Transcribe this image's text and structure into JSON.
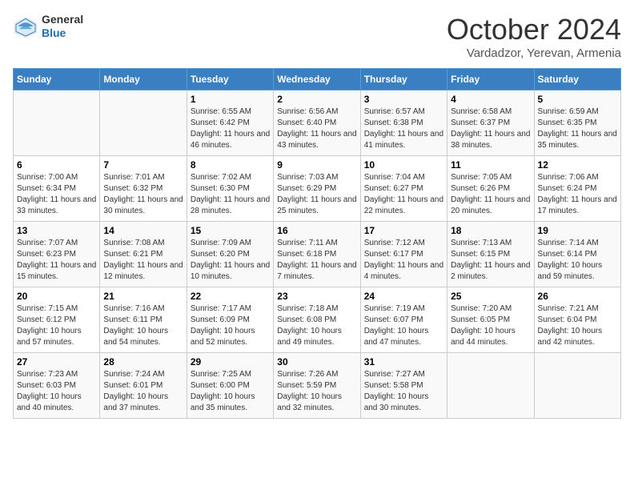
{
  "header": {
    "logo_general": "General",
    "logo_blue": "Blue",
    "month": "October 2024",
    "location": "Vardadzor, Yerevan, Armenia"
  },
  "days_of_week": [
    "Sunday",
    "Monday",
    "Tuesday",
    "Wednesday",
    "Thursday",
    "Friday",
    "Saturday"
  ],
  "weeks": [
    [
      {
        "day": "",
        "info": ""
      },
      {
        "day": "",
        "info": ""
      },
      {
        "day": "1",
        "sunrise": "Sunrise: 6:55 AM",
        "sunset": "Sunset: 6:42 PM",
        "daylight": "Daylight: 11 hours and 46 minutes."
      },
      {
        "day": "2",
        "sunrise": "Sunrise: 6:56 AM",
        "sunset": "Sunset: 6:40 PM",
        "daylight": "Daylight: 11 hours and 43 minutes."
      },
      {
        "day": "3",
        "sunrise": "Sunrise: 6:57 AM",
        "sunset": "Sunset: 6:38 PM",
        "daylight": "Daylight: 11 hours and 41 minutes."
      },
      {
        "day": "4",
        "sunrise": "Sunrise: 6:58 AM",
        "sunset": "Sunset: 6:37 PM",
        "daylight": "Daylight: 11 hours and 38 minutes."
      },
      {
        "day": "5",
        "sunrise": "Sunrise: 6:59 AM",
        "sunset": "Sunset: 6:35 PM",
        "daylight": "Daylight: 11 hours and 35 minutes."
      }
    ],
    [
      {
        "day": "6",
        "sunrise": "Sunrise: 7:00 AM",
        "sunset": "Sunset: 6:34 PM",
        "daylight": "Daylight: 11 hours and 33 minutes."
      },
      {
        "day": "7",
        "sunrise": "Sunrise: 7:01 AM",
        "sunset": "Sunset: 6:32 PM",
        "daylight": "Daylight: 11 hours and 30 minutes."
      },
      {
        "day": "8",
        "sunrise": "Sunrise: 7:02 AM",
        "sunset": "Sunset: 6:30 PM",
        "daylight": "Daylight: 11 hours and 28 minutes."
      },
      {
        "day": "9",
        "sunrise": "Sunrise: 7:03 AM",
        "sunset": "Sunset: 6:29 PM",
        "daylight": "Daylight: 11 hours and 25 minutes."
      },
      {
        "day": "10",
        "sunrise": "Sunrise: 7:04 AM",
        "sunset": "Sunset: 6:27 PM",
        "daylight": "Daylight: 11 hours and 22 minutes."
      },
      {
        "day": "11",
        "sunrise": "Sunrise: 7:05 AM",
        "sunset": "Sunset: 6:26 PM",
        "daylight": "Daylight: 11 hours and 20 minutes."
      },
      {
        "day": "12",
        "sunrise": "Sunrise: 7:06 AM",
        "sunset": "Sunset: 6:24 PM",
        "daylight": "Daylight: 11 hours and 17 minutes."
      }
    ],
    [
      {
        "day": "13",
        "sunrise": "Sunrise: 7:07 AM",
        "sunset": "Sunset: 6:23 PM",
        "daylight": "Daylight: 11 hours and 15 minutes."
      },
      {
        "day": "14",
        "sunrise": "Sunrise: 7:08 AM",
        "sunset": "Sunset: 6:21 PM",
        "daylight": "Daylight: 11 hours and 12 minutes."
      },
      {
        "day": "15",
        "sunrise": "Sunrise: 7:09 AM",
        "sunset": "Sunset: 6:20 PM",
        "daylight": "Daylight: 11 hours and 10 minutes."
      },
      {
        "day": "16",
        "sunrise": "Sunrise: 7:11 AM",
        "sunset": "Sunset: 6:18 PM",
        "daylight": "Daylight: 11 hours and 7 minutes."
      },
      {
        "day": "17",
        "sunrise": "Sunrise: 7:12 AM",
        "sunset": "Sunset: 6:17 PM",
        "daylight": "Daylight: 11 hours and 4 minutes."
      },
      {
        "day": "18",
        "sunrise": "Sunrise: 7:13 AM",
        "sunset": "Sunset: 6:15 PM",
        "daylight": "Daylight: 11 hours and 2 minutes."
      },
      {
        "day": "19",
        "sunrise": "Sunrise: 7:14 AM",
        "sunset": "Sunset: 6:14 PM",
        "daylight": "Daylight: 10 hours and 59 minutes."
      }
    ],
    [
      {
        "day": "20",
        "sunrise": "Sunrise: 7:15 AM",
        "sunset": "Sunset: 6:12 PM",
        "daylight": "Daylight: 10 hours and 57 minutes."
      },
      {
        "day": "21",
        "sunrise": "Sunrise: 7:16 AM",
        "sunset": "Sunset: 6:11 PM",
        "daylight": "Daylight: 10 hours and 54 minutes."
      },
      {
        "day": "22",
        "sunrise": "Sunrise: 7:17 AM",
        "sunset": "Sunset: 6:09 PM",
        "daylight": "Daylight: 10 hours and 52 minutes."
      },
      {
        "day": "23",
        "sunrise": "Sunrise: 7:18 AM",
        "sunset": "Sunset: 6:08 PM",
        "daylight": "Daylight: 10 hours and 49 minutes."
      },
      {
        "day": "24",
        "sunrise": "Sunrise: 7:19 AM",
        "sunset": "Sunset: 6:07 PM",
        "daylight": "Daylight: 10 hours and 47 minutes."
      },
      {
        "day": "25",
        "sunrise": "Sunrise: 7:20 AM",
        "sunset": "Sunset: 6:05 PM",
        "daylight": "Daylight: 10 hours and 44 minutes."
      },
      {
        "day": "26",
        "sunrise": "Sunrise: 7:21 AM",
        "sunset": "Sunset: 6:04 PM",
        "daylight": "Daylight: 10 hours and 42 minutes."
      }
    ],
    [
      {
        "day": "27",
        "sunrise": "Sunrise: 7:23 AM",
        "sunset": "Sunset: 6:03 PM",
        "daylight": "Daylight: 10 hours and 40 minutes."
      },
      {
        "day": "28",
        "sunrise": "Sunrise: 7:24 AM",
        "sunset": "Sunset: 6:01 PM",
        "daylight": "Daylight: 10 hours and 37 minutes."
      },
      {
        "day": "29",
        "sunrise": "Sunrise: 7:25 AM",
        "sunset": "Sunset: 6:00 PM",
        "daylight": "Daylight: 10 hours and 35 minutes."
      },
      {
        "day": "30",
        "sunrise": "Sunrise: 7:26 AM",
        "sunset": "Sunset: 5:59 PM",
        "daylight": "Daylight: 10 hours and 32 minutes."
      },
      {
        "day": "31",
        "sunrise": "Sunrise: 7:27 AM",
        "sunset": "Sunset: 5:58 PM",
        "daylight": "Daylight: 10 hours and 30 minutes."
      },
      {
        "day": "",
        "info": ""
      },
      {
        "day": "",
        "info": ""
      }
    ]
  ]
}
